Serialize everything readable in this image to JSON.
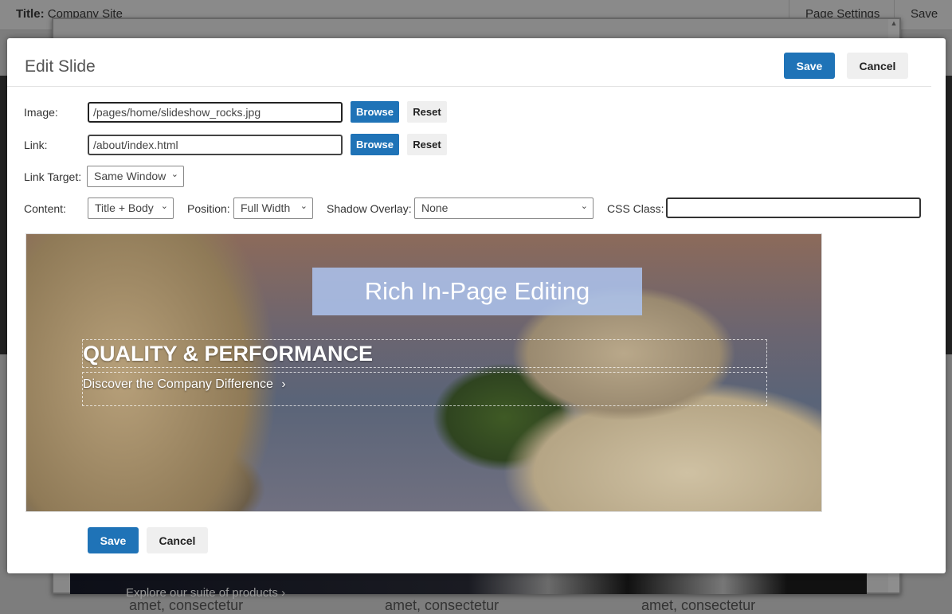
{
  "background": {
    "title_label": "Title:",
    "title_value": "Company Site",
    "page_settings": "Page Settings",
    "save": "Save",
    "explore": "Explore our suite of products ›",
    "amet": [
      "amet, consectetur",
      "amet, consectetur",
      "amet, consectetur"
    ]
  },
  "modal": {
    "title": "Edit Slide",
    "save": "Save",
    "cancel": "Cancel",
    "image": {
      "label": "Image:",
      "value": "/pages/home/slideshow_rocks.jpg",
      "browse": "Browse",
      "reset": "Reset"
    },
    "link": {
      "label": "Link:",
      "value": "/about/index.html",
      "browse": "Browse",
      "reset": "Reset"
    },
    "link_target": {
      "label": "Link Target:",
      "value": "Same Window"
    },
    "content": {
      "label": "Content:",
      "value": "Title + Body"
    },
    "position": {
      "label": "Position:",
      "value": "Full Width"
    },
    "shadow": {
      "label": "Shadow Overlay:",
      "value": "None"
    },
    "css_class": {
      "label": "CSS Class:",
      "value": ""
    },
    "slide": {
      "band": "Rich In-Page Editing",
      "heading": "QUALITY & PERFORMANCE",
      "subtitle": "Discover the Company Difference",
      "chevron": "›"
    },
    "footer_save": "Save",
    "footer_cancel": "Cancel"
  },
  "colors": {
    "primary": "#1f73b7",
    "secondary": "#efefef"
  }
}
